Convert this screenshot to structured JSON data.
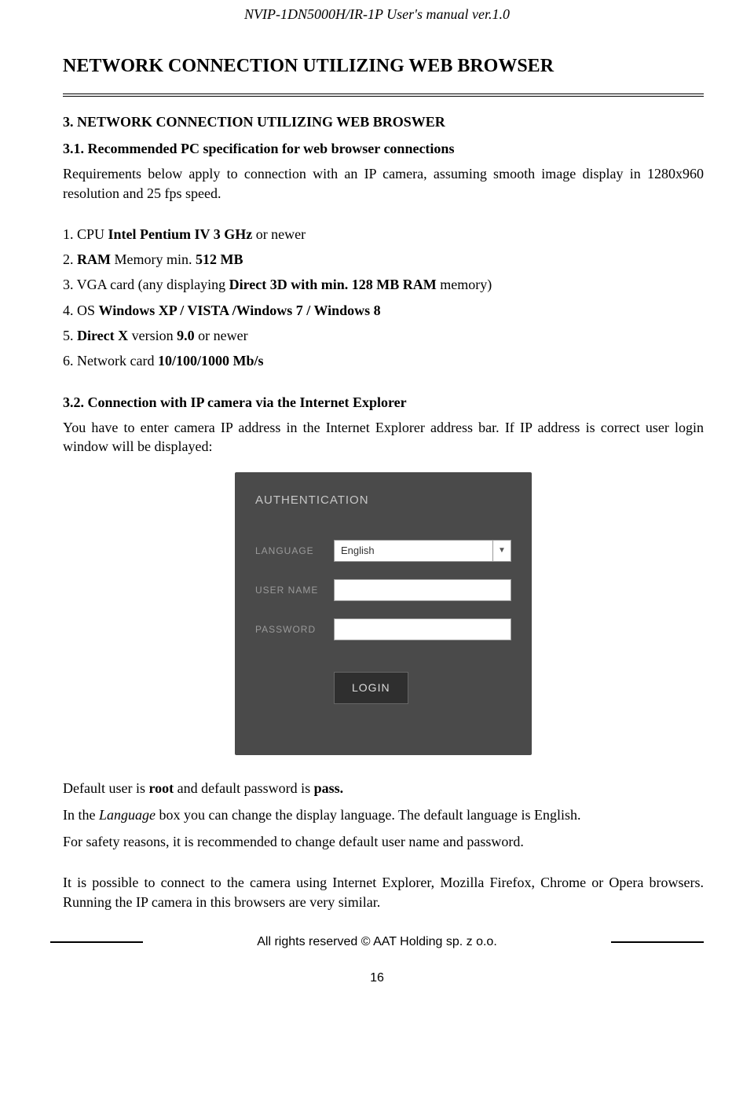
{
  "header": "NVIP-1DN5000H/IR-1P User's manual ver.1.0",
  "lang_tab": "eng",
  "title": "NETWORK CONNECTION UTILIZING WEB BROWSER",
  "section3": "3. NETWORK CONNECTION UTILIZING WEB BROSWER",
  "section31": "3.1. Recommended PC specification for web browser connections",
  "para31": "Requirements below apply to connection with an IP camera, assuming smooth image display in 1280x960 resolution and 25 fps speed.",
  "specs": {
    "s1a": "1. CPU ",
    "s1b": "Intel Pentium IV 3 GHz",
    "s1c": " or newer",
    "s2a": "2. ",
    "s2b": "RAM",
    "s2c": " Memory min. ",
    "s2d": "512 MB",
    "s3a": "3. VGA card (any displaying ",
    "s3b": "Direct 3D with min. 128 MB RAM",
    "s3c": " memory)",
    "s4a": "4. OS ",
    "s4b": "Windows XP / VISTA /Windows 7 / Windows 8",
    "s5a": "5. ",
    "s5b": "Direct X",
    "s5c": " version ",
    "s5d": "9.0",
    "s5e": " or newer",
    "s6a": "6. Network card ",
    "s6b": "10/100/1000 Mb/s"
  },
  "section32": "3.2. Connection with IP camera via the Internet Explorer",
  "para32": "You have to enter camera IP address in the Internet Explorer address bar. If IP address is correct user login window will be displayed:",
  "auth": {
    "title": "AUTHENTICATION",
    "lang_label": "LANGUAGE",
    "lang_value": "English",
    "user_label": "USER NAME",
    "user_value": "",
    "pass_label": "PASSWORD",
    "pass_value": "",
    "login": "LOGIN"
  },
  "p_default_a": "Default user is ",
  "p_default_b": "root",
  "p_default_c": " and default password is ",
  "p_default_d": "pass.",
  "p_lang_a": "In the ",
  "p_lang_b": "Language",
  "p_lang_c": " box you can change the display language. The default language is English.",
  "p_safety": "For safety reasons, it is recommended to change default user name and password.",
  "p_browsers": "It is possible to connect to the camera using Internet Explorer, Mozilla Firefox, Chrome or Opera browsers. Running the IP camera in this browsers are very similar.",
  "footer_text": "All rights reserved © AAT Holding sp. z o.o.",
  "page_num": "16"
}
